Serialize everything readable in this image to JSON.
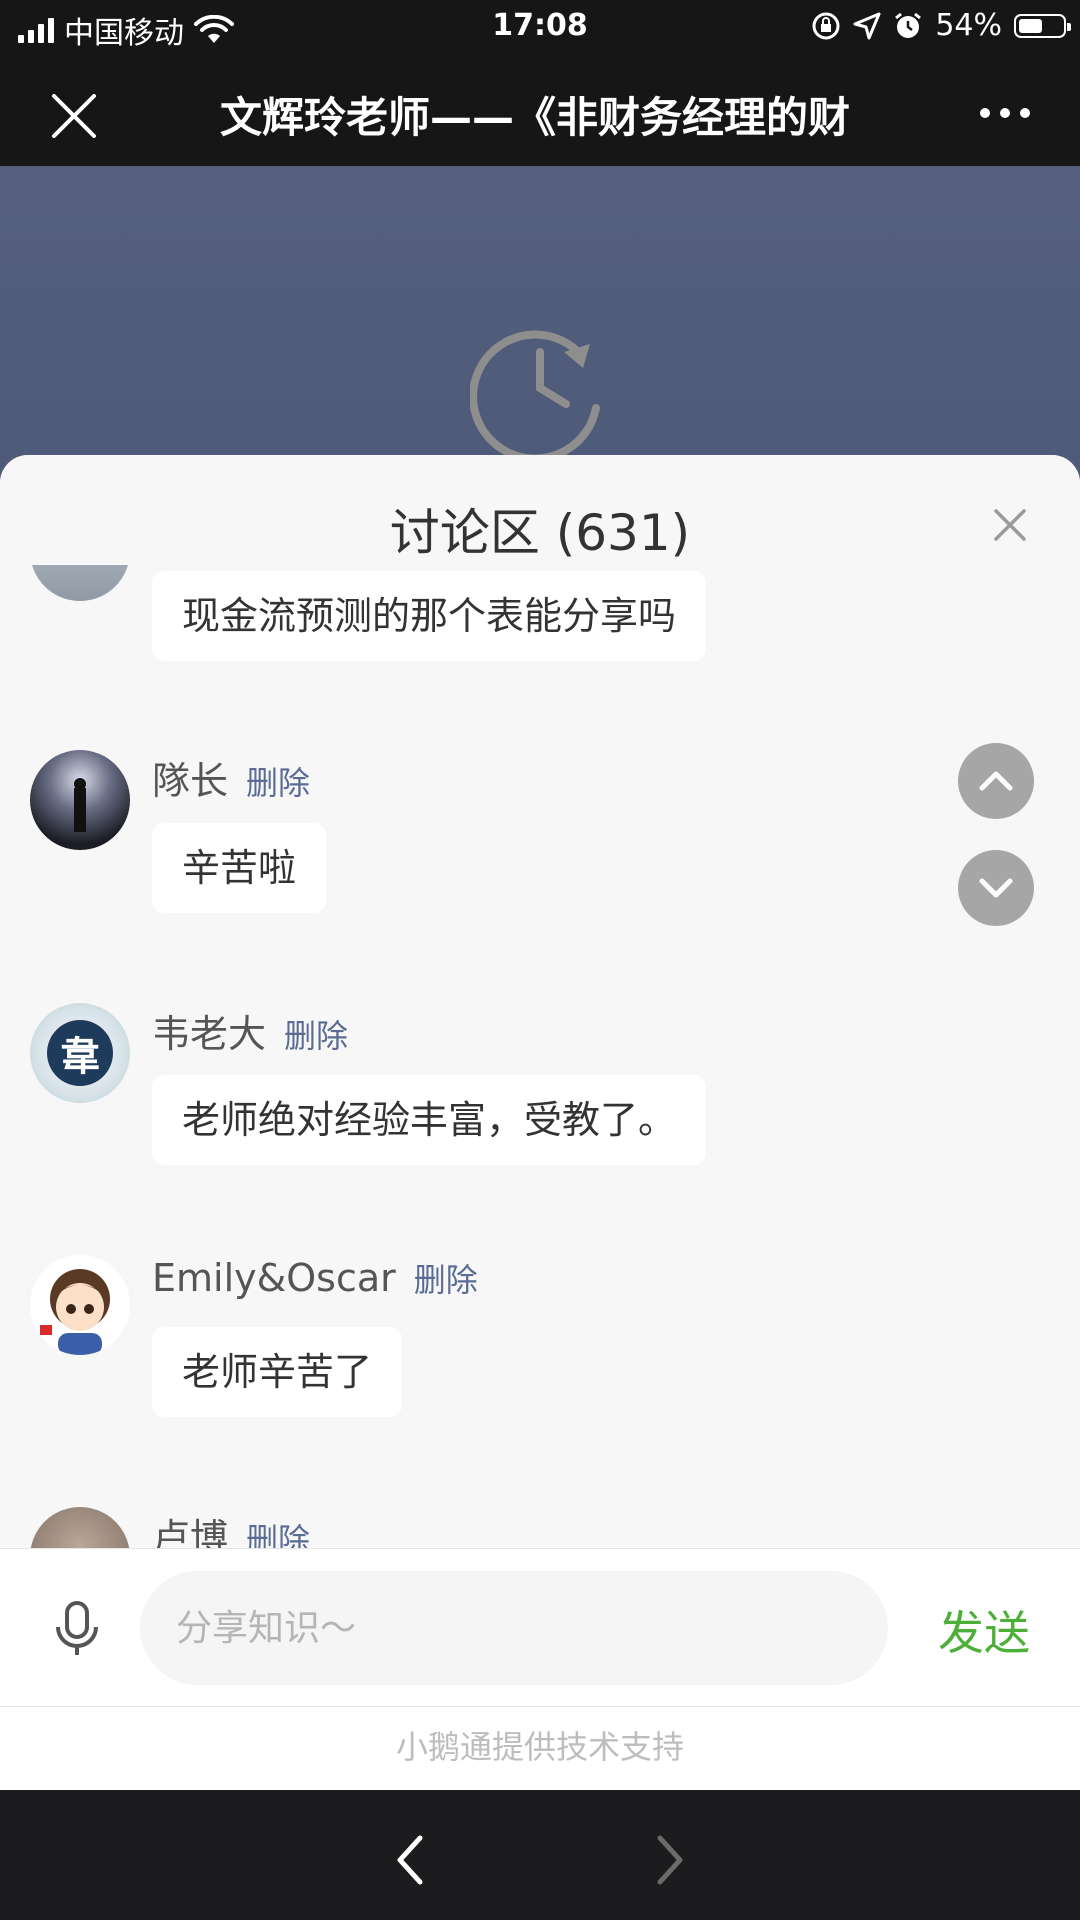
{
  "status_bar": {
    "carrier": "中国移动",
    "time": "17:08",
    "battery": "54%",
    "battery_level": 0.54
  },
  "nav": {
    "title": "文辉玲老师——《非财务经理的财"
  },
  "discussion": {
    "title": "讨论区 (631)",
    "delete_label": "删除",
    "messages": [
      {
        "user": "",
        "text": "现金流预测的那个表能分享吗"
      },
      {
        "user": "隊长",
        "text": "辛苦啦"
      },
      {
        "user": "韦老大",
        "text": "老师绝对经验丰富，受教了。"
      },
      {
        "user": "Emily&Oscar",
        "text": "老师辛苦了"
      },
      {
        "user": "卢博",
        "text": ""
      }
    ],
    "avatar_glyph": "韋"
  },
  "input": {
    "placeholder": "分享知识～",
    "send_label": "发送"
  },
  "footer": {
    "powered_by": "小鹅通提供技术支持"
  },
  "colors": {
    "send": "#4cb038",
    "delete": "#5a6c93",
    "video_bg": "#515b7a"
  },
  "icons": [
    "close-icon",
    "more-icon",
    "history-clock-icon",
    "chevron-up-icon",
    "chevron-down-icon",
    "microphone-icon",
    "back-arrow-icon",
    "forward-arrow-icon"
  ]
}
